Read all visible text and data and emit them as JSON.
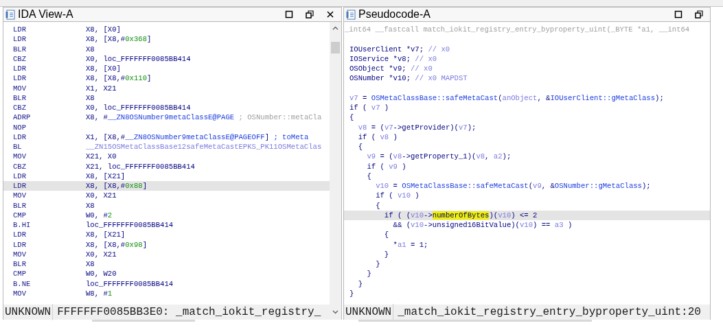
{
  "panes": [
    {
      "title": "IDA View-A",
      "kind": "disassembly",
      "buttons": [
        {
          "kind": "maximize"
        },
        {
          "kind": "restore"
        },
        {
          "kind": "close"
        }
      ],
      "rows": [
        {
          "mnemonic": "LDR",
          "operands": [
            {
              "kind": "t",
              "text": "X8, [X0]"
            }
          ],
          "selected": false
        },
        {
          "mnemonic": "LDR",
          "operands": [
            {
              "kind": "t",
              "text": "X8, [X8,#"
            },
            {
              "kind": "g",
              "text": "0x368"
            },
            {
              "kind": "t",
              "text": "]"
            }
          ],
          "selected": false
        },
        {
          "mnemonic": "BLR",
          "operands": [
            {
              "kind": "t",
              "text": "X8"
            }
          ],
          "selected": false
        },
        {
          "mnemonic": "CBZ",
          "operands": [
            {
              "kind": "t",
              "text": "X0, loc_FFFFFFF0085BB414"
            }
          ],
          "selected": false
        },
        {
          "mnemonic": "LDR",
          "operands": [
            {
              "kind": "t",
              "text": "X8, [X0]"
            }
          ],
          "selected": false
        },
        {
          "mnemonic": "LDR",
          "operands": [
            {
              "kind": "t",
              "text": "X8, [X8,#"
            },
            {
              "kind": "g",
              "text": "0x110"
            },
            {
              "kind": "t",
              "text": "]"
            }
          ],
          "selected": false
        },
        {
          "mnemonic": "MOV",
          "operands": [
            {
              "kind": "t",
              "text": "X1, X21"
            }
          ],
          "selected": false
        },
        {
          "mnemonic": "BLR",
          "operands": [
            {
              "kind": "t",
              "text": "X8"
            }
          ],
          "selected": false
        },
        {
          "mnemonic": "CBZ",
          "operands": [
            {
              "kind": "t",
              "text": "X0, loc_FFFFFFF0085BB414"
            }
          ],
          "selected": false
        },
        {
          "mnemonic": "ADRP",
          "operands": [
            {
              "kind": "t",
              "text": "X8, #"
            },
            {
              "kind": "n",
              "text": "__ZN8OSNumber9metaClassE@PAGE"
            },
            {
              "kind": "c",
              "text": " ; OSNumber::metaCla"
            }
          ],
          "selected": false
        },
        {
          "mnemonic": "NOP",
          "selected": false
        },
        {
          "mnemonic": "LDR",
          "operands": [
            {
              "kind": "t",
              "text": "X1, [X8,#"
            },
            {
              "kind": "n",
              "text": "__ZN8OSNumber9metaClassE@PAGEOFF"
            },
            {
              "kind": "t",
              "text": "] "
            },
            {
              "kind": "n",
              "text": "; toMeta"
            }
          ],
          "selected": false
        },
        {
          "mnemonic": "BL",
          "operands": [
            {
              "kind": "v",
              "text": "__ZN15OSMetaClassBase12safeMetaCastEPKS_PK11OSMetaClas"
            }
          ],
          "selected": false
        },
        {
          "mnemonic": "MOV",
          "operands": [
            {
              "kind": "t",
              "text": "X21, X0"
            }
          ],
          "selected": false
        },
        {
          "mnemonic": "CBZ",
          "operands": [
            {
              "kind": "t",
              "text": "X21, loc_FFFFFFF0085BB414"
            }
          ],
          "selected": false
        },
        {
          "mnemonic": "LDR",
          "operands": [
            {
              "kind": "t",
              "text": "X8, [X21]"
            }
          ],
          "selected": false
        },
        {
          "mnemonic": "LDR",
          "operands": [
            {
              "kind": "t",
              "text": "X8, [X8,#"
            },
            {
              "kind": "g",
              "text": "0x88"
            },
            {
              "kind": "t",
              "text": "]"
            }
          ],
          "selected": true
        },
        {
          "mnemonic": "MOV",
          "operands": [
            {
              "kind": "t",
              "text": "X0, X21"
            }
          ],
          "selected": false
        },
        {
          "mnemonic": "BLR",
          "operands": [
            {
              "kind": "t",
              "text": "X8"
            }
          ],
          "selected": false
        },
        {
          "mnemonic": "CMP",
          "operands": [
            {
              "kind": "t",
              "text": "W0, #"
            },
            {
              "kind": "g",
              "text": "2"
            }
          ],
          "selected": false
        },
        {
          "mnemonic": "B.HI",
          "operands": [
            {
              "kind": "t",
              "text": "loc_FFFFFFF0085BB414"
            }
          ],
          "selected": false
        },
        {
          "mnemonic": "LDR",
          "operands": [
            {
              "kind": "t",
              "text": "X8, [X21]"
            }
          ],
          "selected": false
        },
        {
          "mnemonic": "LDR",
          "operands": [
            {
              "kind": "t",
              "text": "X8, [X8,#"
            },
            {
              "kind": "g",
              "text": "0x98"
            },
            {
              "kind": "t",
              "text": "]"
            }
          ],
          "selected": false
        },
        {
          "mnemonic": "MOV",
          "operands": [
            {
              "kind": "t",
              "text": "X0, X21"
            }
          ],
          "selected": false
        },
        {
          "mnemonic": "BLR",
          "operands": [
            {
              "kind": "t",
              "text": "X8"
            }
          ],
          "selected": false
        },
        {
          "mnemonic": "CMP",
          "operands": [
            {
              "kind": "t",
              "text": "W0, W20"
            }
          ],
          "selected": false
        },
        {
          "mnemonic": "B.NE",
          "operands": [
            {
              "kind": "t",
              "text": "loc_FFFFFFF0085BB414"
            }
          ],
          "selected": false
        },
        {
          "mnemonic": "MOV",
          "operands": [
            {
              "kind": "t",
              "text": "W8, #"
            },
            {
              "kind": "g",
              "text": "1"
            }
          ],
          "selected": false
        }
      ],
      "status": [
        "UNKNOWN",
        "FFFFFFF0085BB3E0: _match_iokit_registry_"
      ]
    },
    {
      "title": "Pseudocode-A",
      "kind": "pseudocode",
      "buttons": [
        {
          "kind": "maximize"
        },
        {
          "kind": "restore"
        }
      ],
      "rows": [
        {
          "kind": "header",
          "segments": [
            {
              "kind": "c",
              "text": "_int64 __fastcall match_iokit_registry_entry_byproperty_uint(_BYTE *a1, __int64"
            }
          ],
          "selected": false
        },
        {
          "kind": "blank",
          "selected": false
        },
        {
          "kind": "code",
          "segments": [
            {
              "kind": "t",
              "text": "IOUserClient *v7; "
            },
            {
              "kind": "v",
              "text": "// x0"
            }
          ],
          "selected": false
        },
        {
          "kind": "code",
          "segments": [
            {
              "kind": "t",
              "text": "IOService *v8; "
            },
            {
              "kind": "v",
              "text": "// x0"
            }
          ],
          "selected": false
        },
        {
          "kind": "code",
          "segments": [
            {
              "kind": "t",
              "text": "OSObject *v9; "
            },
            {
              "kind": "v",
              "text": "// x0"
            }
          ],
          "selected": false
        },
        {
          "kind": "code",
          "segments": [
            {
              "kind": "t",
              "text": "OSNumber *v10; "
            },
            {
              "kind": "v",
              "text": "// x0 MAPDST"
            }
          ],
          "selected": false
        },
        {
          "kind": "blank",
          "selected": false
        },
        {
          "kind": "code",
          "segments": [
            {
              "kind": "v",
              "text": "v7"
            },
            {
              "kind": "t",
              "text": " = "
            },
            {
              "kind": "n",
              "text": "OSMetaClassBase::safeMetaCast"
            },
            {
              "kind": "t",
              "text": "("
            },
            {
              "kind": "v",
              "text": "anObject"
            },
            {
              "kind": "t",
              "text": ", &"
            },
            {
              "kind": "n",
              "text": "IOUserClient::gMetaClass"
            },
            {
              "kind": "t",
              "text": ");"
            }
          ],
          "selected": false
        },
        {
          "kind": "code",
          "segments": [
            {
              "kind": "t",
              "text": "if ( "
            },
            {
              "kind": "v",
              "text": "v7"
            },
            {
              "kind": "t",
              "text": " )"
            }
          ],
          "selected": false
        },
        {
          "kind": "code",
          "segments": [
            {
              "kind": "t",
              "text": "{"
            }
          ],
          "selected": false
        },
        {
          "kind": "code",
          "segments": [
            {
              "kind": "v",
              "text": "  v8"
            },
            {
              "kind": "t",
              "text": " = ("
            },
            {
              "kind": "v",
              "text": "v7"
            },
            {
              "kind": "t",
              "text": "->getProvider)("
            },
            {
              "kind": "v",
              "text": "v7"
            },
            {
              "kind": "t",
              "text": ");"
            }
          ],
          "selected": false
        },
        {
          "kind": "code",
          "segments": [
            {
              "kind": "t",
              "text": "  if ( "
            },
            {
              "kind": "v",
              "text": "v8"
            },
            {
              "kind": "t",
              "text": " )"
            }
          ],
          "selected": false
        },
        {
          "kind": "code",
          "segments": [
            {
              "kind": "t",
              "text": "  {"
            }
          ],
          "selected": false
        },
        {
          "kind": "code",
          "segments": [
            {
              "kind": "v",
              "text": "    v9"
            },
            {
              "kind": "t",
              "text": " = ("
            },
            {
              "kind": "v",
              "text": "v8"
            },
            {
              "kind": "t",
              "text": "->getProperty_1)("
            },
            {
              "kind": "v",
              "text": "v8"
            },
            {
              "kind": "t",
              "text": ", "
            },
            {
              "kind": "v",
              "text": "a2"
            },
            {
              "kind": "t",
              "text": ");"
            }
          ],
          "selected": false
        },
        {
          "kind": "code",
          "segments": [
            {
              "kind": "t",
              "text": "    if ( "
            },
            {
              "kind": "v",
              "text": "v9"
            },
            {
              "kind": "t",
              "text": " )"
            }
          ],
          "selected": false
        },
        {
          "kind": "code",
          "segments": [
            {
              "kind": "t",
              "text": "    {"
            }
          ],
          "selected": false
        },
        {
          "kind": "code",
          "segments": [
            {
              "kind": "v",
              "text": "      v10"
            },
            {
              "kind": "t",
              "text": " = "
            },
            {
              "kind": "n",
              "text": "OSMetaClassBase::safeMetaCast"
            },
            {
              "kind": "t",
              "text": "("
            },
            {
              "kind": "v",
              "text": "v9"
            },
            {
              "kind": "t",
              "text": ", &"
            },
            {
              "kind": "n",
              "text": "OSNumber::gMetaClass"
            },
            {
              "kind": "t",
              "text": ");"
            }
          ],
          "selected": false
        },
        {
          "kind": "code",
          "segments": [
            {
              "kind": "t",
              "text": "      if ( "
            },
            {
              "kind": "v",
              "text": "v10"
            },
            {
              "kind": "t",
              "text": " )"
            }
          ],
          "selected": false
        },
        {
          "kind": "code",
          "segments": [
            {
              "kind": "t",
              "text": "      {"
            }
          ],
          "selected": false
        },
        {
          "kind": "code",
          "segments": [
            {
              "kind": "t",
              "text": "        if ( ("
            },
            {
              "kind": "v",
              "text": "v10"
            },
            {
              "kind": "t",
              "text": "->"
            },
            {
              "kind": "h",
              "text": "numberOfBytes"
            },
            {
              "kind": "t",
              "text": ")("
            },
            {
              "kind": "v",
              "text": "v10"
            },
            {
              "kind": "t",
              "text": ") <= 2"
            }
          ],
          "selected": true
        },
        {
          "kind": "code",
          "segments": [
            {
              "kind": "t",
              "text": "          && ("
            },
            {
              "kind": "v",
              "text": "v10"
            },
            {
              "kind": "t",
              "text": "->unsigned16BitValue)("
            },
            {
              "kind": "v",
              "text": "v10"
            },
            {
              "kind": "t",
              "text": ") == "
            },
            {
              "kind": "v",
              "text": "a3"
            },
            {
              "kind": "t",
              "text": " )"
            }
          ],
          "selected": false
        },
        {
          "kind": "code",
          "segments": [
            {
              "kind": "t",
              "text": "        {"
            }
          ],
          "selected": false
        },
        {
          "kind": "code",
          "segments": [
            {
              "kind": "t",
              "text": "          *"
            },
            {
              "kind": "v",
              "text": "a1"
            },
            {
              "kind": "t",
              "text": " = 1;"
            }
          ],
          "selected": false
        },
        {
          "kind": "code",
          "segments": [
            {
              "kind": "t",
              "text": "        }"
            }
          ],
          "selected": false
        },
        {
          "kind": "code",
          "segments": [
            {
              "kind": "t",
              "text": "      }"
            }
          ],
          "selected": false
        },
        {
          "kind": "code",
          "segments": [
            {
              "kind": "t",
              "text": "    }"
            }
          ],
          "selected": false
        },
        {
          "kind": "code",
          "segments": [
            {
              "kind": "t",
              "text": "  }"
            }
          ],
          "selected": false
        },
        {
          "kind": "code",
          "segments": [
            {
              "kind": "t",
              "text": "}"
            }
          ],
          "selected": false
        }
      ],
      "status": [
        "UNKNOWN",
        "_match_iokit_registry_entry_byproperty_uint:20"
      ]
    }
  ]
}
